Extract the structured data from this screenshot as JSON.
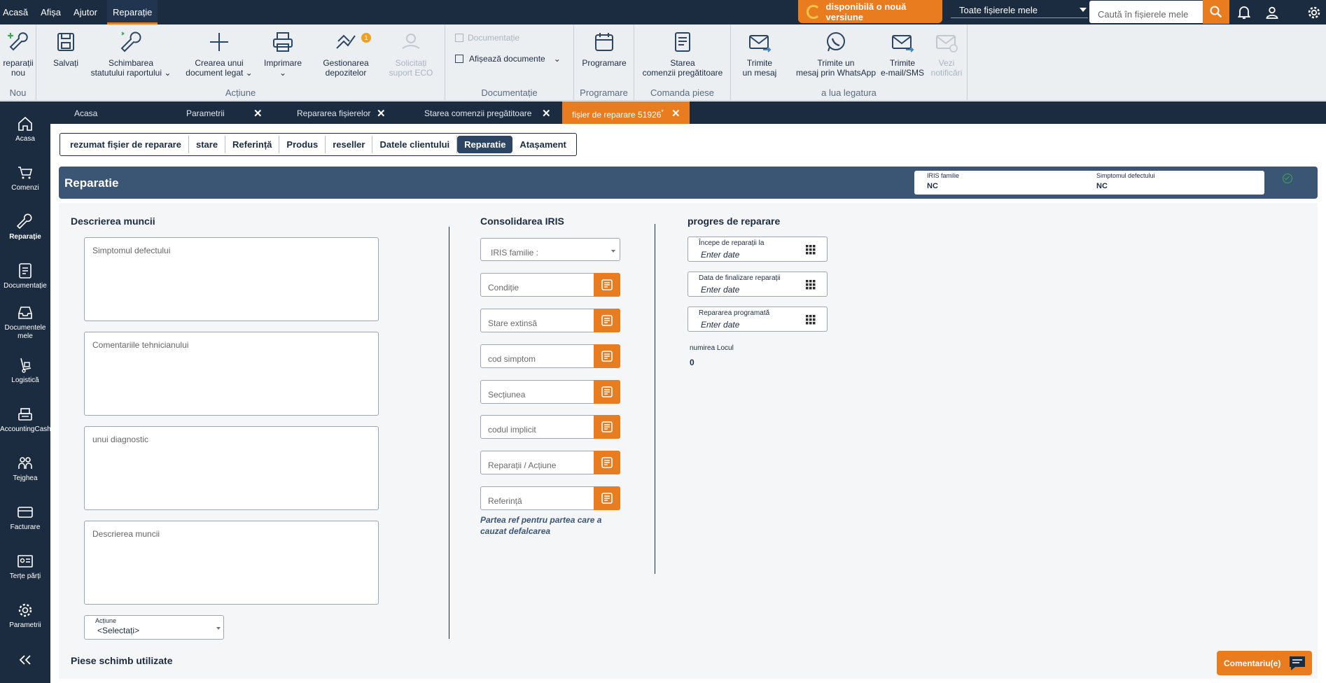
{
  "topmenu": {
    "items": [
      "Acasă",
      "Afișa",
      "Ajutor",
      "Reparație"
    ],
    "active": "Reparație"
  },
  "topbar": {
    "new_version": "disponibilă o nouă versiune",
    "file_filter": "Toate fișierele mele",
    "search_placeholder": "Caută în fișierele mele"
  },
  "ribbon": {
    "new_label_1": "reparații",
    "new_label_2": "nou",
    "group_new": "Nou",
    "save": "Salvați",
    "change_status_1": "Schimbarea",
    "change_status_2": "statutului raportului",
    "create_doc_1": "Crearea unui",
    "create_doc_2": "document legat",
    "print": "Imprimare",
    "depots_1": "Gestionarea",
    "depots_2": "depozitelor",
    "depots_badge": "1",
    "eco_1": "Solicitați",
    "eco_2": "suport ECO",
    "group_actions": "Acțiune",
    "documentation_disabled": "Documentație",
    "show_docs": "Afișează documente",
    "group_documentation": "Documentație",
    "scheduling": "Programare",
    "group_scheduling": "Programare",
    "order_status_1": "Starea",
    "order_status_2": "comenzii pregătitoare",
    "group_parts": "Comanda piese",
    "send_msg_1": "Trimite",
    "send_msg_2": "un mesaj",
    "whatsapp_1": "Trimite un",
    "whatsapp_2": "mesaj prin WhatsApp",
    "email_1": "Trimite",
    "email_2": "e-mail/SMS",
    "notif_1": "Vezi",
    "notif_2": "notificări",
    "group_contact": "a lua legatura"
  },
  "sidebar": {
    "items": [
      {
        "label1": "Acasa",
        "label2": ""
      },
      {
        "label1": "Comenzi",
        "label2": ""
      },
      {
        "label1": "Reparație",
        "label2": ""
      },
      {
        "label1": "Documentație",
        "label2": ""
      },
      {
        "label1": "Documentele",
        "label2": "mele"
      },
      {
        "label1": "Logistică",
        "label2": ""
      },
      {
        "label1": "AccountingCash",
        "label2": ""
      },
      {
        "label1": "Tejghea",
        "label2": ""
      },
      {
        "label1": "Facturare",
        "label2": ""
      },
      {
        "label1": "Terțe părți",
        "label2": ""
      },
      {
        "label1": "Parametrii",
        "label2": ""
      }
    ]
  },
  "tabs": [
    {
      "label": "Acasa"
    },
    {
      "label": "Parametrii"
    },
    {
      "label": "Repararea fișierelor"
    },
    {
      "label": "Starea comenzii pregătitoare"
    },
    {
      "label": "fișier de reparare 51926",
      "modified": "*"
    }
  ],
  "subnav": [
    "rezumat fișier de reparare",
    "stare",
    "Referință",
    "Produs",
    "reseller",
    "Datele clientului",
    "Reparatie",
    "Atașament"
  ],
  "section": {
    "title": "Reparatie",
    "iris_family_label": "IRIS familie",
    "iris_family_value": "NC",
    "symptom_label": "Simptomul defectului",
    "symptom_value": "NC"
  },
  "work": {
    "title": "Descrierea muncii",
    "fields": [
      "Simptomul defectului",
      "Comentariile tehnicianului",
      "unui diagnostic",
      "Descrierea muncii"
    ],
    "action_label": "Acțiune",
    "action_value": "<Selectați>"
  },
  "iris": {
    "title": "Consolidarea IRIS",
    "family_placeholder": "IRIS familie :",
    "fields": [
      "Condiție",
      "Stare extinsă",
      "cod simptom",
      "Secțiunea",
      "codul implicit",
      "Reparații / Acțiune",
      "Referință"
    ],
    "note_1": "Partea ref pentru partea care a",
    "note_2": "cauzat defalcarea"
  },
  "progress": {
    "title": "progres de reparare",
    "fields": [
      {
        "label": "Începe de reparații la",
        "placeholder": "Enter date"
      },
      {
        "label": "Data de finalizare reparații",
        "placeholder": "Enter date"
      },
      {
        "label": "Repararea programată",
        "placeholder": "Enter date"
      }
    ],
    "place_label": "numirea Locul",
    "place_value": "0"
  },
  "parts": {
    "title": "Piese schimb utilizate"
  },
  "comments": {
    "label": "Comentariu(e)"
  },
  "colors": {
    "navy": "#1c2c40",
    "accent": "#e87c1e",
    "section": "#3b5574"
  }
}
